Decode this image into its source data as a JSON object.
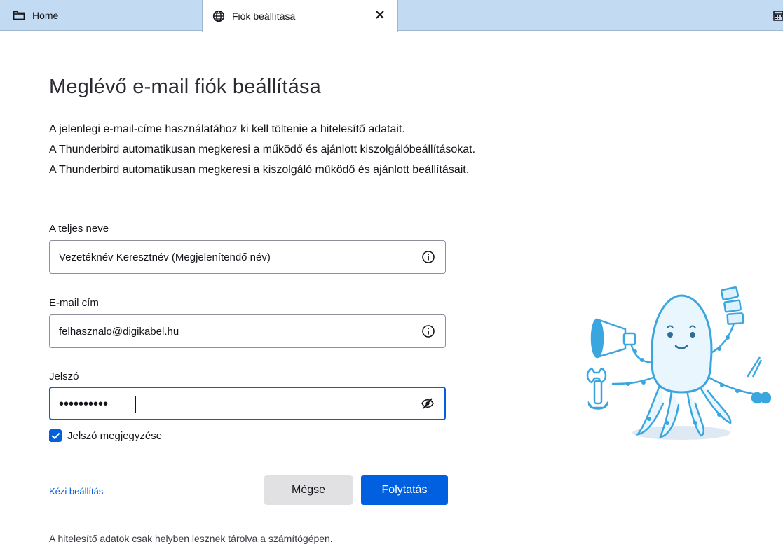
{
  "tabs": [
    {
      "label": "Home",
      "icon": "folder-icon"
    },
    {
      "label": "Fiók beállítása",
      "icon": "globe-icon",
      "active": true
    }
  ],
  "page": {
    "title": "Meglévő e-mail fiók beállítása",
    "description": [
      "A jelenlegi e-mail-címe használatához ki kell töltenie a hitelesítő adatait.",
      "A Thunderbird automatikusan megkeresi a működő és ajánlott kiszolgálóbeállításokat.",
      "A Thunderbird automatikusan megkeresi a kiszolgáló működő és ajánlott beállításait."
    ]
  },
  "form": {
    "name": {
      "label": "A teljes neve",
      "value": "Vezetéknév Keresztnév (Megjelenítendő név)",
      "icon": "info-icon"
    },
    "email": {
      "label": "E-mail cím",
      "value": "felhasznalo@digikabel.hu",
      "icon": "info-icon"
    },
    "password": {
      "label": "Jelszó",
      "masked": "••••••••••",
      "icon": "eye-slash-icon"
    },
    "remember": {
      "label": "Jelszó megjegyzése",
      "checked": true
    }
  },
  "actions": {
    "manual": "Kézi beállítás",
    "cancel": "Mégse",
    "continue": "Folytatás"
  },
  "footer": "A hitelesítő adatok csak helyben lesznek tárolva a számítógépen.",
  "colors": {
    "accent": "#0060df",
    "tabbar": "#c2dbf3",
    "mascot": "#3aa6e0"
  }
}
